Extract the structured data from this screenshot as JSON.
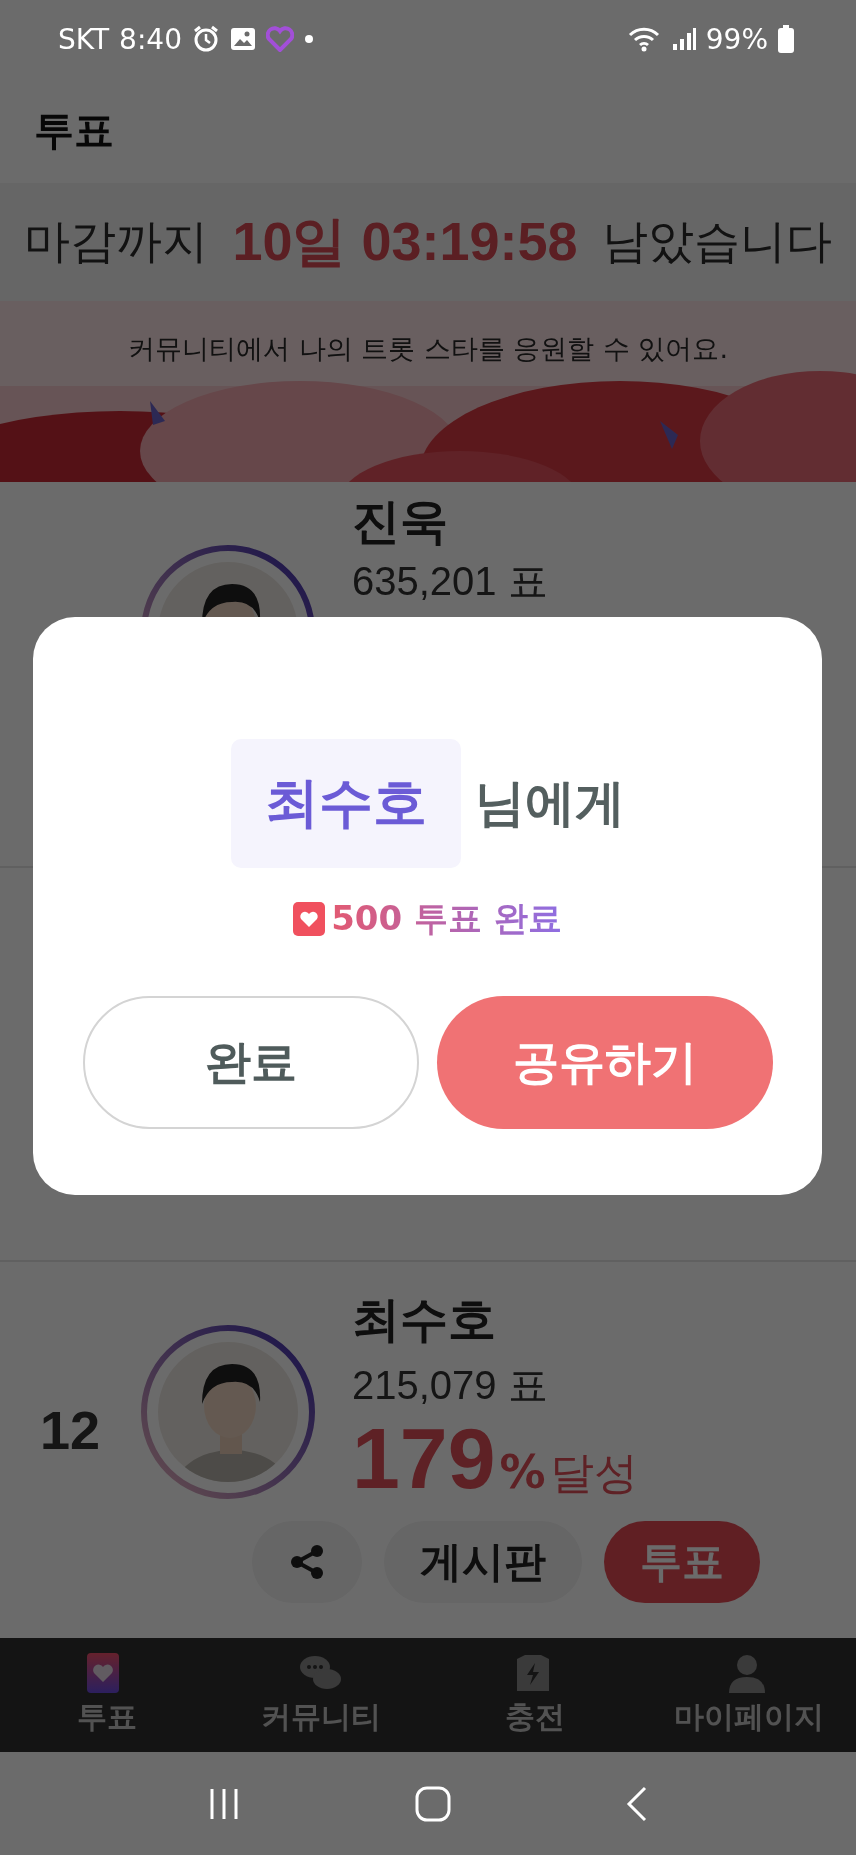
{
  "status_bar": {
    "carrier": "SKT",
    "time": "8:40",
    "battery": "99%"
  },
  "header": {
    "title": "투표"
  },
  "countdown": {
    "prefix": "마감까지",
    "remaining": "10일 03:19:58",
    "suffix": "남았습니다"
  },
  "banner": {
    "text": "커뮤니티에서 나의 트롯 스타를 응원할 수 있어요.",
    "kind": "picture"
  },
  "candidates": [
    {
      "name": "진욱",
      "votes": "635,201 표"
    },
    {
      "rank": "12",
      "name": "최수호",
      "votes": "215,079 표",
      "percent": "179",
      "percent_sign": "%",
      "achieved": "달성",
      "actions": [
        "게시판",
        "투표"
      ]
    }
  ],
  "bottom_nav": [
    {
      "label": "투표",
      "selected": true,
      "kind": "vote"
    },
    {
      "label": "커뮤니티",
      "selected": false,
      "kind": "community"
    },
    {
      "label": "충전",
      "selected": false,
      "kind": "charge"
    },
    {
      "label": "마이페이지",
      "selected": false,
      "kind": "mypage"
    }
  ],
  "dialog": {
    "recipient": "최수호",
    "suffix": "님에게",
    "result": "500 투표 완료",
    "buttons": [
      {
        "label": "완료",
        "kind": "secondary"
      },
      {
        "label": "공유하기",
        "kind": "primary"
      }
    ]
  }
}
